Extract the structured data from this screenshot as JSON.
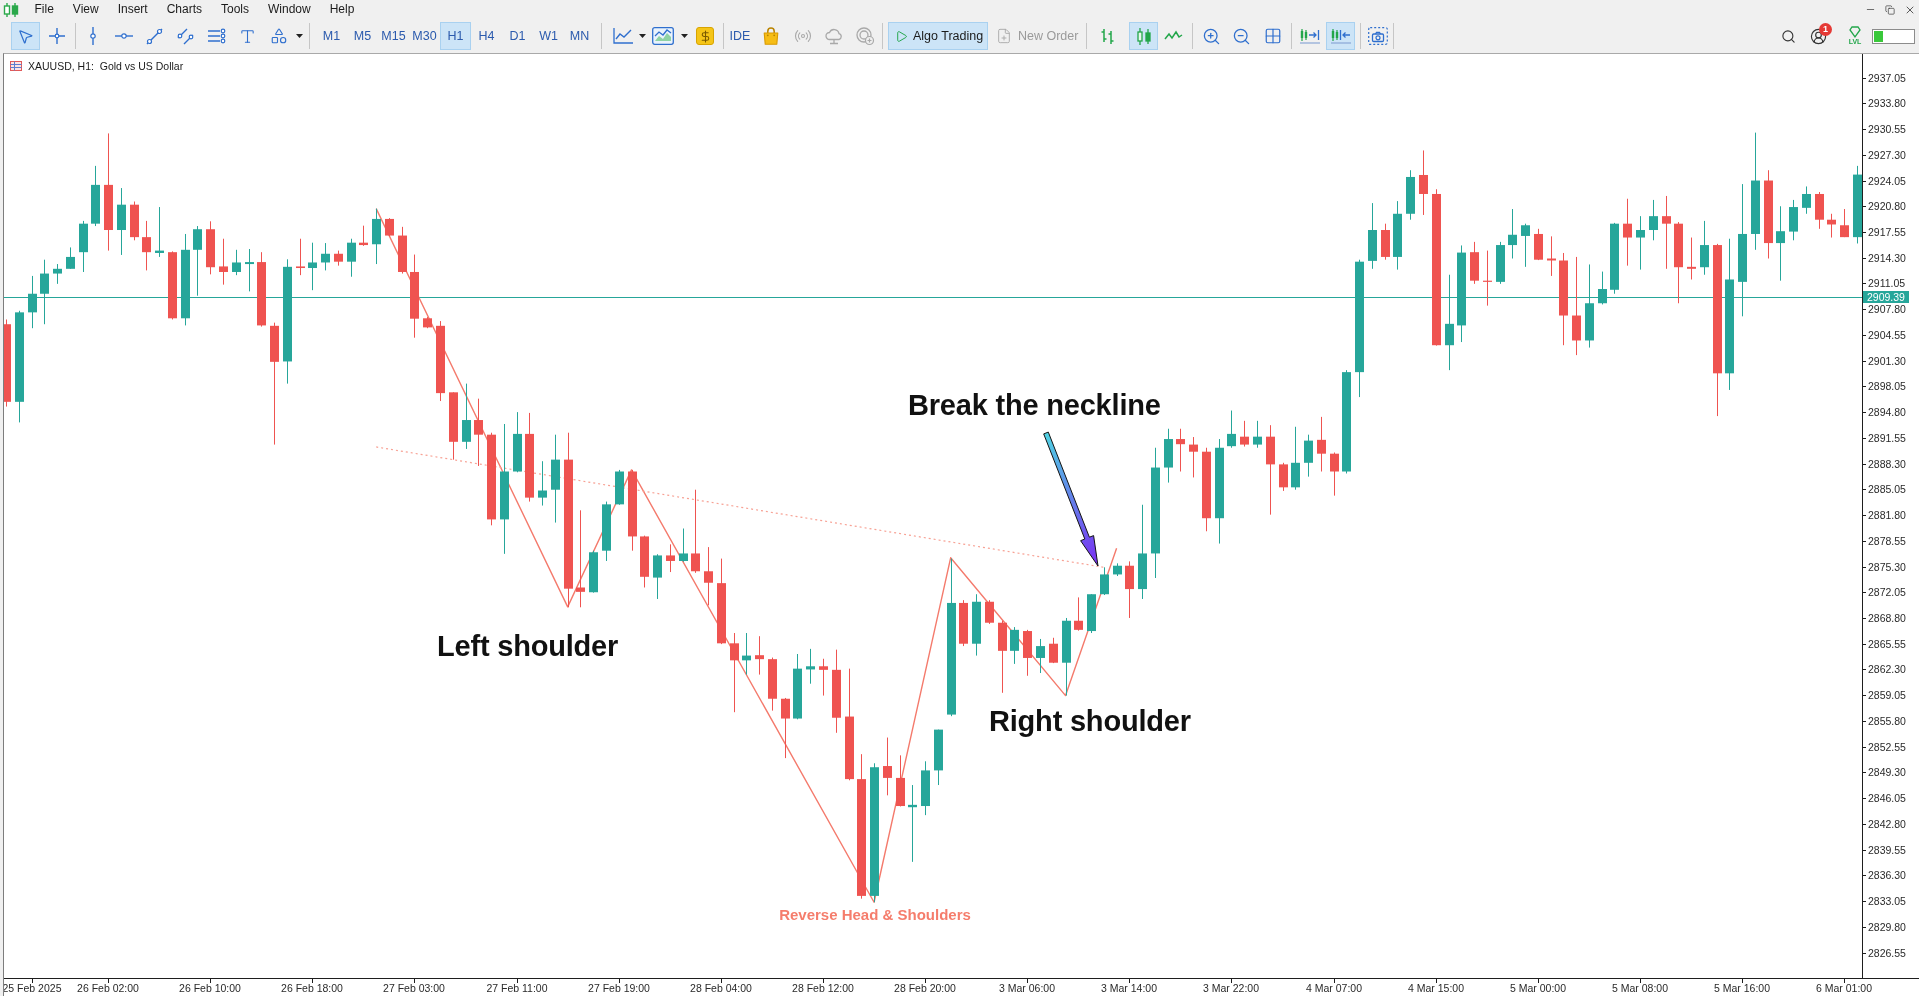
{
  "menu": [
    "File",
    "View",
    "Insert",
    "Charts",
    "Tools",
    "Window",
    "Help"
  ],
  "toolbar": {
    "drawing_tools": [
      {
        "selected": true
      },
      {
        "selected": false
      },
      {
        "selected": false
      },
      {
        "selected": false
      },
      {
        "selected": false
      },
      {
        "selected": false
      },
      {
        "selected": false
      },
      {
        "selected": false
      },
      {
        "selected": false
      }
    ],
    "timeframes": [
      {
        "label": "M1",
        "selected": false
      },
      {
        "label": "M5",
        "selected": false
      },
      {
        "label": "M15",
        "selected": false
      },
      {
        "label": "M30",
        "selected": false
      },
      {
        "label": "H1",
        "selected": true
      },
      {
        "label": "H4",
        "selected": false
      },
      {
        "label": "D1",
        "selected": false
      },
      {
        "label": "W1",
        "selected": false
      },
      {
        "label": "MN",
        "selected": false
      }
    ],
    "ide": "IDE",
    "services": [
      {
        "disabled": false
      },
      {
        "disabled": true
      },
      {
        "disabled": true
      },
      {
        "disabled": true
      }
    ],
    "algo_trading": {
      "label": "Algo Trading",
      "on": true
    },
    "new_order": {
      "label": "New Order",
      "disabled": true
    },
    "chart_types": [
      {
        "selected": false
      },
      {
        "selected": true
      },
      {
        "selected": false
      }
    ],
    "chart_scroll": [
      {
        "selected": false
      },
      {
        "selected": true
      }
    ],
    "notifications": "1",
    "level": {
      "label": "LVL",
      "level": 0.22
    }
  },
  "chart": {
    "title": "XAUUSD, H1:  Gold vs US Dollar",
    "chart_data": [
      {
        "type": "candlestick",
        "categories": [
          null,
          null,
          "25 Feb 2025",
          null,
          null,
          null,
          null,
          null,
          "26 Feb 02:00",
          null,
          null,
          null,
          null,
          null,
          null,
          null,
          "26 Feb 10:00",
          null,
          null,
          null,
          null,
          null,
          null,
          null,
          "26 Feb 18:00",
          null,
          null,
          null,
          null,
          null,
          null,
          null,
          "27 Feb 03:00",
          null,
          null,
          null,
          null,
          null,
          null,
          null,
          "27 Feb 11:00",
          null,
          null,
          null,
          null,
          null,
          null,
          null,
          "27 Feb 19:00",
          null,
          null,
          null,
          null,
          null,
          null,
          null,
          "28 Feb 04:00",
          null,
          null,
          null,
          null,
          null,
          null,
          null,
          "28 Feb 12:00",
          null,
          null,
          null,
          null,
          null,
          null,
          null,
          "28 Feb 20:00",
          null,
          null,
          null,
          null,
          null,
          null,
          null,
          "3 Mar 06:00",
          null,
          null,
          null,
          null,
          null,
          null,
          null,
          "3 Mar 14:00",
          null,
          null,
          null,
          null,
          null,
          null,
          null,
          "3 Mar 22:00",
          null,
          null,
          null,
          null,
          null,
          null,
          null,
          "4 Mar 07:00",
          null,
          null,
          null,
          null,
          null,
          null,
          null,
          "4 Mar 15:00",
          null,
          null,
          null,
          null,
          null,
          null,
          null,
          "5 Mar 00:00",
          null,
          null,
          null,
          null,
          null,
          null,
          null,
          "5 Mar 08:00",
          null,
          null,
          null,
          null,
          null,
          null,
          null,
          "5 Mar 16:00",
          null,
          null,
          null,
          null,
          null,
          null,
          null,
          "6 Mar 01:00",
          null
        ],
        "ohlc": [
          [
            2905.9,
            2906.5,
            2895.5,
            2896.1
          ],
          [
            2896.1,
            2907.6,
            2893.5,
            2907.4
          ],
          [
            2907.4,
            2912.0,
            2905.4,
            2909.75
          ],
          [
            2909.75,
            2914.05,
            2905.9,
            2912.3
          ],
          [
            2912.3,
            2913.5,
            2911.0,
            2912.9
          ],
          [
            2912.9,
            2915.6,
            2912.9,
            2914.4
          ],
          [
            2915.0,
            2918.95,
            2912.5,
            2918.6
          ],
          [
            2918.6,
            2925.9,
            2918.3,
            2923.5
          ],
          [
            2923.5,
            2930.0,
            2915.2,
            2917.8
          ],
          [
            2917.8,
            2923.1,
            2914.65,
            2921.0
          ],
          [
            2921.0,
            2921.4,
            2916.5,
            2916.9
          ],
          [
            2916.9,
            2918.95,
            2912.7,
            2915.0
          ],
          [
            2914.9,
            2920.7,
            2914.4,
            2915.2
          ],
          [
            2915.0,
            2915.1,
            2906.5,
            2906.65
          ],
          [
            2906.65,
            2917.3,
            2905.75,
            2915.3
          ],
          [
            2915.3,
            2918.3,
            2909.5,
            2917.9
          ],
          [
            2917.9,
            2918.9,
            2912.2,
            2913.1
          ],
          [
            2913.2,
            2916.7,
            2910.9,
            2912.5
          ],
          [
            2912.5,
            2915.3,
            2912.1,
            2913.7
          ],
          [
            2913.5,
            2915.4,
            2910.05,
            2913.75
          ],
          [
            2913.75,
            2915.0,
            2905.6,
            2905.75
          ],
          [
            2905.7,
            2906.1,
            2890.7,
            2901.15
          ],
          [
            2901.2,
            2914.1,
            2898.4,
            2913.15
          ],
          [
            2913.2,
            2916.7,
            2912.1,
            2913.0
          ],
          [
            2913.0,
            2916.2,
            2910.2,
            2913.7
          ],
          [
            2913.7,
            2916.15,
            2912.7,
            2914.8
          ],
          [
            2914.8,
            2915.2,
            2913.3,
            2913.8
          ],
          [
            2913.8,
            2916.7,
            2911.9,
            2916.2
          ],
          [
            2916.2,
            2918.35,
            2915.8,
            2915.9
          ],
          [
            2916.0,
            2920.5,
            2913.5,
            2919.2
          ],
          [
            2919.2,
            2919.3,
            2917.0,
            2917.1
          ],
          [
            2917.1,
            2918.2,
            2912.3,
            2912.5
          ],
          [
            2912.5,
            2914.7,
            2904.2,
            2906.6
          ],
          [
            2906.65,
            2906.8,
            2905.4,
            2905.5
          ],
          [
            2905.7,
            2906.3,
            2896.2,
            2897.2
          ],
          [
            2897.3,
            2897.3,
            2888.8,
            2891.05
          ],
          [
            2891.05,
            2898.4,
            2890.15,
            2893.8
          ],
          [
            2893.8,
            2896.5,
            2888.0,
            2891.95
          ],
          [
            2891.95,
            2892.2,
            2880.5,
            2881.25
          ],
          [
            2881.25,
            2893.3,
            2876.9,
            2887.3
          ],
          [
            2887.3,
            2894.8,
            2887.2,
            2892.05
          ],
          [
            2892.05,
            2894.7,
            2883.5,
            2884.0
          ],
          [
            2884.0,
            2888.6,
            2883.0,
            2884.9
          ],
          [
            2885.0,
            2891.95,
            2880.85,
            2888.8
          ],
          [
            2888.8,
            2892.2,
            2870.15,
            2872.5
          ],
          [
            2872.65,
            2882.4,
            2870.15,
            2872.1
          ],
          [
            2872.05,
            2877.3,
            2872.0,
            2877.1
          ],
          [
            2877.3,
            2883.5,
            2876.0,
            2883.15
          ],
          [
            2883.15,
            2887.5,
            2883.1,
            2887.3
          ],
          [
            2887.3,
            2887.5,
            2877.3,
            2879.1
          ],
          [
            2879.1,
            2879.2,
            2872.65,
            2874.0
          ],
          [
            2873.9,
            2876.85,
            2871.2,
            2876.7
          ],
          [
            2876.7,
            2878.1,
            2874.6,
            2876.0
          ],
          [
            2876.0,
            2880.1,
            2875.9,
            2876.95
          ],
          [
            2876.95,
            2885.0,
            2874.5,
            2874.7
          ],
          [
            2874.7,
            2877.75,
            2870.4,
            2873.25
          ],
          [
            2873.2,
            2876.3,
            2865.5,
            2865.6
          ],
          [
            2865.6,
            2866.9,
            2856.9,
            2863.45
          ],
          [
            2863.45,
            2866.9,
            2861.65,
            2864.05
          ],
          [
            2864.1,
            2866.5,
            2861.65,
            2863.6
          ],
          [
            2863.6,
            2863.8,
            2857.1,
            2858.6
          ],
          [
            2858.6,
            2858.7,
            2851.1,
            2856.1
          ],
          [
            2856.1,
            2864.25,
            2856.0,
            2862.4
          ],
          [
            2862.3,
            2864.9,
            2860.5,
            2862.7
          ],
          [
            2862.7,
            2863.65,
            2859.0,
            2862.25
          ],
          [
            2862.25,
            2864.8,
            2854.3,
            2856.2
          ],
          [
            2856.35,
            2862.4,
            2848.3,
            2848.45
          ],
          [
            2848.45,
            2851.6,
            2833.35,
            2833.7
          ],
          [
            2833.7,
            2850.45,
            2832.9,
            2849.95
          ],
          [
            2850.1,
            2853.7,
            2846.4,
            2848.6
          ],
          [
            2848.6,
            2851.45,
            2845.0,
            2845.05
          ],
          [
            2844.9,
            2847.7,
            2838.0,
            2845.2
          ],
          [
            2845.05,
            2850.7,
            2843.9,
            2849.55
          ],
          [
            2849.55,
            2854.7,
            2847.7,
            2854.7
          ],
          [
            2856.6,
            2876.3,
            2856.4,
            2870.7
          ],
          [
            2870.7,
            2871.05,
            2865.25,
            2865.55
          ],
          [
            2865.55,
            2871.8,
            2864.05,
            2870.85
          ],
          [
            2870.85,
            2871.05,
            2868.05,
            2868.2
          ],
          [
            2868.2,
            2868.45,
            2859.35,
            2864.65
          ],
          [
            2864.65,
            2867.65,
            2863.0,
            2867.3
          ],
          [
            2867.15,
            2867.3,
            2861.5,
            2863.75
          ],
          [
            2863.75,
            2866.15,
            2861.85,
            2865.25
          ],
          [
            2865.55,
            2866.3,
            2863.1,
            2863.15
          ],
          [
            2863.15,
            2868.8,
            2859.0,
            2868.45
          ],
          [
            2868.45,
            2871.4,
            2867.2,
            2867.3
          ],
          [
            2867.15,
            2871.8,
            2866.9,
            2871.8
          ],
          [
            2871.8,
            2875.2,
            2871.7,
            2874.3
          ],
          [
            2874.3,
            2875.7,
            2874.1,
            2875.4
          ],
          [
            2875.4,
            2875.95,
            2868.8,
            2872.45
          ],
          [
            2872.45,
            2883.1,
            2871.2,
            2876.95
          ],
          [
            2876.95,
            2890.3,
            2873.85,
            2887.8
          ],
          [
            2887.8,
            2892.7,
            2885.9,
            2891.4
          ],
          [
            2891.4,
            2892.7,
            2887.3,
            2890.75
          ],
          [
            2890.7,
            2891.65,
            2886.55,
            2889.8
          ],
          [
            2889.8,
            2890.3,
            2879.75,
            2881.4
          ],
          [
            2881.4,
            2891.4,
            2878.2,
            2890.3
          ],
          [
            2890.5,
            2895.0,
            2890.3,
            2892.05
          ],
          [
            2891.7,
            2893.7,
            2890.45,
            2890.7
          ],
          [
            2890.7,
            2893.7,
            2890.3,
            2891.7
          ],
          [
            2891.7,
            2893.15,
            2881.85,
            2888.2
          ],
          [
            2888.2,
            2888.4,
            2884.85,
            2885.3
          ],
          [
            2885.3,
            2892.95,
            2885.0,
            2888.4
          ],
          [
            2888.4,
            2891.95,
            2886.65,
            2891.2
          ],
          [
            2891.3,
            2894.2,
            2887.3,
            2889.55
          ],
          [
            2889.55,
            2889.7,
            2884.25,
            2887.3
          ],
          [
            2887.3,
            2900.1,
            2887.05,
            2899.85
          ],
          [
            2899.85,
            2914.05,
            2896.7,
            2913.8
          ],
          [
            2913.9,
            2921.2,
            2912.9,
            2917.8
          ],
          [
            2917.8,
            2918.6,
            2914.05,
            2914.4
          ],
          [
            2914.4,
            2921.45,
            2912.8,
            2919.85
          ],
          [
            2919.85,
            2925.35,
            2919.1,
            2924.5
          ],
          [
            2924.75,
            2927.85,
            2919.7,
            2922.35
          ],
          [
            2922.35,
            2922.95,
            2903.2,
            2903.25
          ],
          [
            2903.25,
            2912.15,
            2900.1,
            2905.95
          ],
          [
            2905.75,
            2915.85,
            2903.65,
            2914.95
          ],
          [
            2915.0,
            2916.3,
            2911.0,
            2911.4
          ],
          [
            2911.4,
            2915.2,
            2908.25,
            2911.25
          ],
          [
            2911.25,
            2916.3,
            2911.0,
            2915.9
          ],
          [
            2915.9,
            2920.45,
            2914.2,
            2917.2
          ],
          [
            2917.05,
            2918.6,
            2913.15,
            2918.4
          ],
          [
            2917.3,
            2917.95,
            2914.0,
            2914.05
          ],
          [
            2914.2,
            2917.0,
            2912.0,
            2913.95
          ],
          [
            2913.95,
            2914.9,
            2903.25,
            2907.0
          ],
          [
            2907.0,
            2914.4,
            2902.0,
            2903.85
          ],
          [
            2903.85,
            2913.45,
            2902.95,
            2908.55
          ],
          [
            2908.55,
            2912.55,
            2908.4,
            2910.35
          ],
          [
            2910.25,
            2918.7,
            2909.75,
            2918.6
          ],
          [
            2918.6,
            2921.75,
            2913.3,
            2916.85
          ],
          [
            2916.85,
            2919.55,
            2912.8,
            2917.8
          ],
          [
            2917.8,
            2921.6,
            2916.5,
            2919.55
          ],
          [
            2919.55,
            2922.1,
            2912.9,
            2918.6
          ],
          [
            2918.6,
            2918.8,
            2908.55,
            2913.1
          ],
          [
            2913.15,
            2916.85,
            2911.55,
            2912.9
          ],
          [
            2913.1,
            2918.95,
            2912.15,
            2915.9
          ],
          [
            2915.9,
            2916.05,
            2894.3,
            2899.7
          ],
          [
            2899.7,
            2916.7,
            2897.6,
            2911.55
          ],
          [
            2911.25,
            2923.6,
            2906.9,
            2917.3
          ],
          [
            2917.3,
            2930.1,
            2915.3,
            2924.05
          ],
          [
            2924.05,
            2925.35,
            2914.2,
            2916.15
          ],
          [
            2916.15,
            2920.8,
            2911.4,
            2917.65
          ],
          [
            2917.6,
            2921.6,
            2916.5,
            2920.7
          ],
          [
            2920.6,
            2923.3,
            2919.85,
            2922.35
          ],
          [
            2922.35,
            2922.6,
            2917.95,
            2919.1
          ],
          [
            2919.1,
            2919.85,
            2916.85,
            2918.5
          ],
          [
            2918.4,
            2920.45,
            2916.9,
            2916.9
          ],
          [
            2916.9,
            2925.9,
            2916.1,
            2924.8
          ]
        ],
        "series": [
          {
            "type": "line",
            "color": "#f47a6c",
            "values": [
              null,
              null,
              null,
              null,
              null,
              null,
              null,
              null,
              null,
              null,
              null,
              null,
              null,
              null,
              null,
              null,
              null,
              null,
              null,
              null,
              null,
              null,
              null,
              null,
              null,
              null,
              null,
              null,
              null,
              2920.5,
              null,
              null,
              null,
              null,
              null,
              null,
              null,
              null,
              null,
              null,
              null,
              null,
              null,
              null,
              2870.2,
              null,
              null,
              null,
              null,
              2887.5,
              null,
              null,
              null,
              null,
              null,
              null,
              null,
              null,
              null,
              null,
              null,
              null,
              null,
              null,
              null,
              null,
              null,
              null,
              2832.9,
              null,
              null,
              null,
              null,
              null,
              2876.4,
              null,
              null,
              null,
              null,
              null,
              null,
              null,
              null,
              2859.0,
              null,
              null,
              null,
              2877.6,
              null,
              null,
              null,
              null,
              null,
              null,
              null,
              null,
              null,
              null,
              null,
              null,
              null,
              null,
              null,
              null,
              null,
              null,
              null,
              null,
              null,
              null,
              null,
              null,
              null,
              null,
              null,
              null,
              null,
              null,
              null,
              null,
              null,
              null,
              null,
              null,
              null,
              null,
              null,
              null,
              null,
              null,
              null,
              null,
              null,
              null,
              null,
              null,
              null,
              null,
              null,
              null,
              null,
              null,
              null,
              null,
              null,
              null
            ]
          },
          {
            "type": "line",
            "line_style": "dotted",
            "color": "#f7a194",
            "values": [
              null,
              null,
              null,
              null,
              null,
              null,
              null,
              null,
              null,
              null,
              null,
              null,
              null,
              null,
              null,
              null,
              null,
              null,
              null,
              null,
              null,
              null,
              null,
              null,
              null,
              null,
              null,
              null,
              null,
              2890.4,
              null,
              null,
              null,
              null,
              null,
              null,
              null,
              null,
              null,
              null,
              null,
              null,
              null,
              null,
              null,
              null,
              null,
              null,
              null,
              null,
              null,
              null,
              null,
              null,
              null,
              null,
              null,
              null,
              null,
              null,
              null,
              null,
              null,
              null,
              null,
              null,
              null,
              null,
              null,
              null,
              null,
              null,
              null,
              null,
              null,
              null,
              null,
              null,
              null,
              null,
              null,
              null,
              null,
              null,
              null,
              null,
              2875.2,
              null,
              null,
              null,
              null,
              null,
              null,
              null,
              null,
              null,
              null,
              null,
              null,
              null,
              null,
              null,
              null,
              null,
              null,
              null,
              null,
              null,
              null,
              null,
              null,
              null,
              null,
              null,
              null,
              null,
              null,
              null,
              null,
              null,
              null,
              null,
              null,
              null,
              null,
              null,
              null,
              null,
              null,
              null,
              null,
              null,
              null,
              null,
              null,
              null,
              null,
              null,
              null,
              null,
              null,
              null,
              null,
              null,
              null,
              null
            ]
          }
        ],
        "ylim": [
          2823.33,
          2940.03
        ],
        "yticks": [
          {
            "value": 2826.55,
            "label": "2826.55"
          },
          {
            "value": 2829.8,
            "label": "2829.80"
          },
          {
            "value": 2833.05,
            "label": "2833.05"
          },
          {
            "value": 2836.3,
            "label": "2836.30"
          },
          {
            "value": 2839.55,
            "label": "2839.55"
          },
          {
            "value": 2842.8,
            "label": "2842.80"
          },
          {
            "value": 2846.05,
            "label": "2846.05"
          },
          {
            "value": 2849.3,
            "label": "2849.30"
          },
          {
            "value": 2852.55,
            "label": "2852.55"
          },
          {
            "value": 2855.8,
            "label": "2855.80"
          },
          {
            "value": 2859.05,
            "label": "2859.05"
          },
          {
            "value": 2862.3,
            "label": "2862.30"
          },
          {
            "value": 2865.55,
            "label": "2865.55"
          },
          {
            "value": 2868.8,
            "label": "2868.80"
          },
          {
            "value": 2872.05,
            "label": "2872.05"
          },
          {
            "value": 2875.3,
            "label": "2875.30"
          },
          {
            "value": 2878.55,
            "label": "2878.55"
          },
          {
            "value": 2881.8,
            "label": "2881.80"
          },
          {
            "value": 2885.05,
            "label": "2885.05"
          },
          {
            "value": 2888.3,
            "label": "2888.30"
          },
          {
            "value": 2891.55,
            "label": "2891.55"
          },
          {
            "value": 2894.8,
            "label": "2894.80"
          },
          {
            "value": 2898.05,
            "label": "2898.05"
          },
          {
            "value": 2901.3,
            "label": "2901.30"
          },
          {
            "value": 2904.55,
            "label": "2904.55"
          },
          {
            "value": 2907.8,
            "label": "2907.80"
          },
          {
            "value": 2911.05,
            "label": "2911.05"
          },
          {
            "value": 2914.3,
            "label": "2914.30"
          },
          {
            "value": 2917.55,
            "label": "2917.55"
          },
          {
            "value": 2920.8,
            "label": "2920.80"
          },
          {
            "value": 2924.05,
            "label": "2924.05"
          },
          {
            "value": 2927.3,
            "label": "2927.30"
          },
          {
            "value": 2930.55,
            "label": "2930.55"
          },
          {
            "value": 2933.8,
            "label": "2933.80"
          },
          {
            "value": 2937.05,
            "label": "2937.05"
          }
        ],
        "ref_lines": [
          {
            "axis": "y",
            "value": 2909.39,
            "label": "2909.39",
            "color": "#26a69a"
          }
        ],
        "annotations": [
          "Break the neckline",
          "Left shoulder",
          "Right shoulder",
          "Reverse Head & Shoulders"
        ]
      }
    ]
  }
}
